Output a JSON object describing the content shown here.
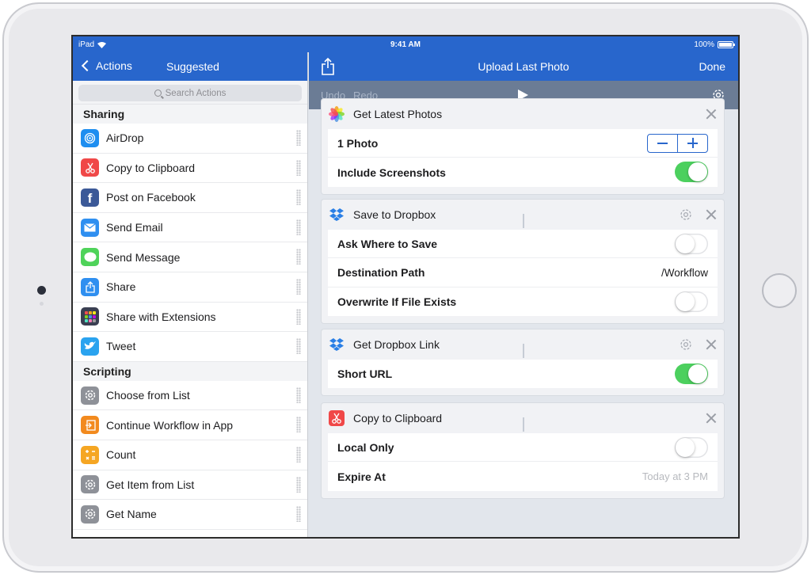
{
  "status_bar": {
    "device": "iPad",
    "time": "9:41 AM",
    "battery": "100%"
  },
  "left_pane": {
    "back_label": "Actions",
    "title": "Suggested",
    "search_placeholder": "Search Actions",
    "sections": [
      {
        "header": "Sharing",
        "items": [
          {
            "label": "AirDrop",
            "icon": "airdrop-icon",
            "color": "#1e8ef0"
          },
          {
            "label": "Copy to Clipboard",
            "icon": "scissors-icon",
            "color": "#f04848"
          },
          {
            "label": "Post on Facebook",
            "icon": "facebook-icon",
            "color": "#3b5998"
          },
          {
            "label": "Send Email",
            "icon": "mail-icon",
            "color": "#2f8ff0"
          },
          {
            "label": "Send Message",
            "icon": "message-icon",
            "color": "#4fd35a"
          },
          {
            "label": "Share",
            "icon": "share-icon",
            "color": "#2f8ff0"
          },
          {
            "label": "Share with Extensions",
            "icon": "extensions-icon",
            "color": "#3a3f52"
          },
          {
            "label": "Tweet",
            "icon": "twitter-icon",
            "color": "#2aa3ef"
          }
        ]
      },
      {
        "header": "Scripting",
        "items": [
          {
            "label": "Choose from List",
            "icon": "gear-icon",
            "color": "#8e9198"
          },
          {
            "label": "Continue Workflow in App",
            "icon": "open-app-icon",
            "color": "#f28a1e"
          },
          {
            "label": "Count",
            "icon": "calculator-icon",
            "color": "#f5a623"
          },
          {
            "label": "Get Item from List",
            "icon": "gear-icon",
            "color": "#8e9198"
          },
          {
            "label": "Get Name",
            "icon": "gear-icon",
            "color": "#8e9198"
          }
        ]
      }
    ]
  },
  "right_pane": {
    "title": "Upload Last Photo",
    "done_label": "Done",
    "undo_label": "Undo",
    "redo_label": "Redo",
    "cards": [
      {
        "title": "Get Latest Photos",
        "icon": "photos-icon",
        "params": [
          {
            "label": "1 Photo",
            "control": "stepper"
          },
          {
            "label": "Include Screenshots",
            "control": "toggle",
            "on": true
          }
        ]
      },
      {
        "title": "Save to Dropbox",
        "icon": "dropbox-icon",
        "params": [
          {
            "label": "Ask Where to Save",
            "control": "toggle",
            "on": false
          },
          {
            "label": "Destination Path",
            "control": "text",
            "value": "/Workflow"
          },
          {
            "label": "Overwrite If File Exists",
            "control": "toggle",
            "on": false
          }
        ]
      },
      {
        "title": "Get Dropbox Link",
        "icon": "dropbox-icon",
        "params": [
          {
            "label": "Short URL",
            "control": "toggle",
            "on": true
          }
        ]
      },
      {
        "title": "Copy to Clipboard",
        "icon": "scissors-icon",
        "params": [
          {
            "label": "Local Only",
            "control": "toggle",
            "on": false
          },
          {
            "label": "Expire At",
            "control": "placeholder",
            "value": "Today at 3 PM"
          }
        ]
      }
    ]
  },
  "colors": {
    "accent": "#2866cc",
    "toolbar": "#6b7c95",
    "toggle_on": "#4cd05e"
  }
}
